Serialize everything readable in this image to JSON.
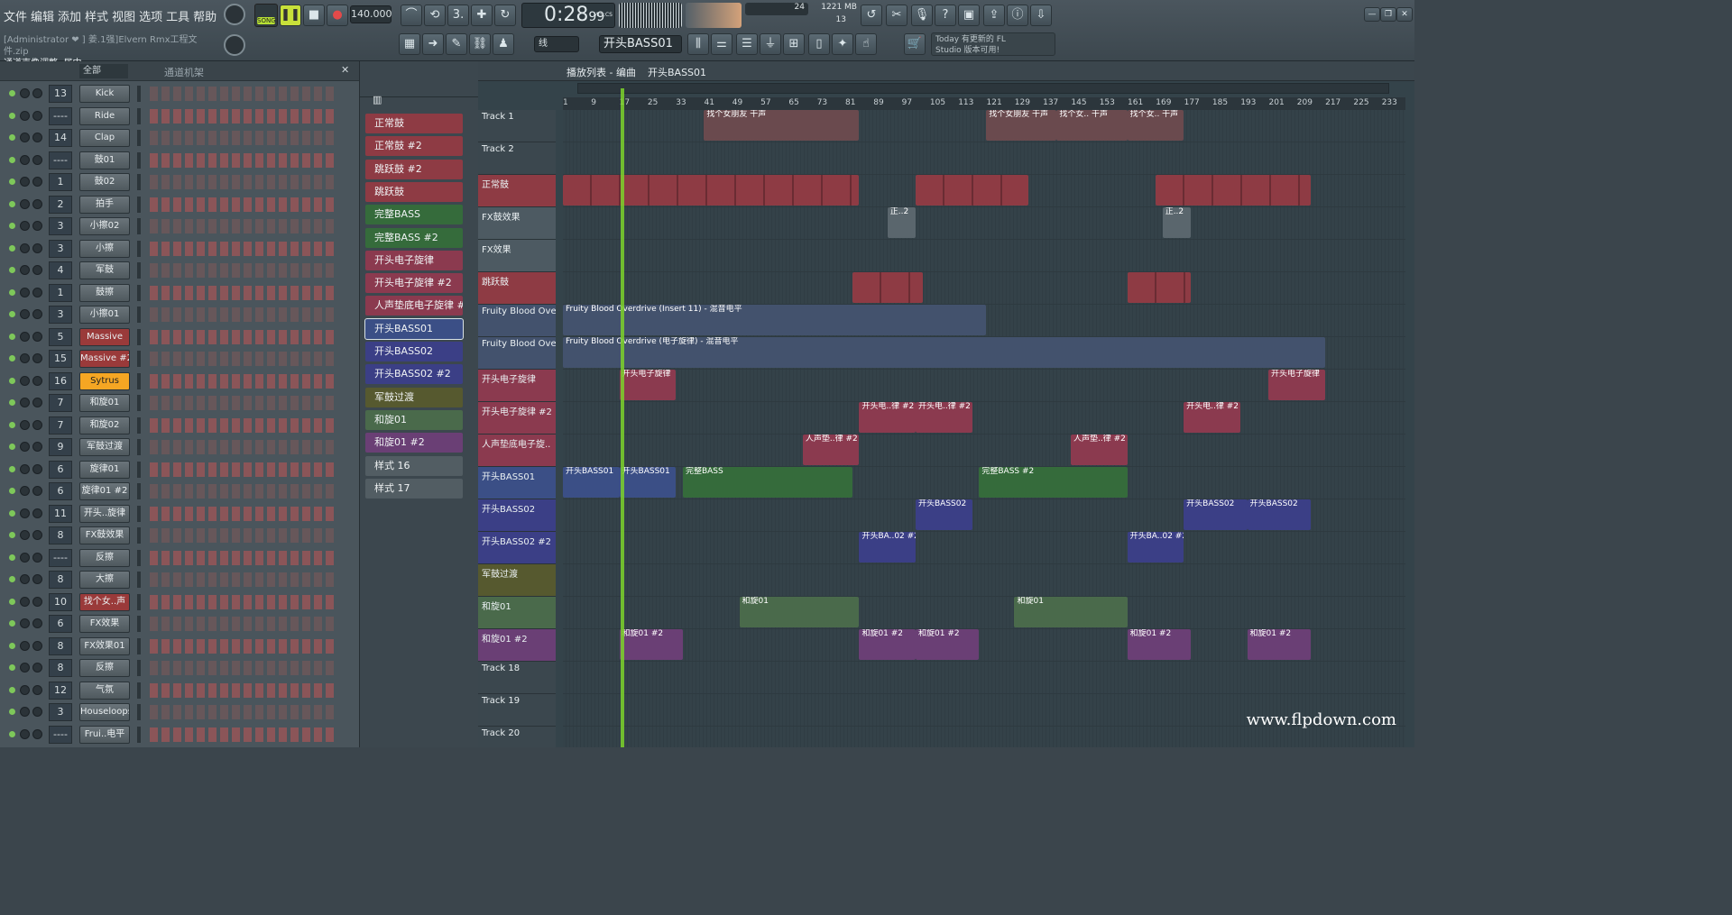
{
  "menu": [
    "文件",
    "编辑",
    "添加",
    "样式",
    "视图",
    "选项",
    "工具",
    "帮助"
  ],
  "transport": {
    "mode": "SONG",
    "bpm": "140.000",
    "time": "0:28",
    "time_sub": "99",
    "time_label": "M:S:CS",
    "cpu": "24",
    "mem": "1221 MB",
    "voices": "13"
  },
  "hint": {
    "line1": "[Administrator ❤ ] 姜.1强]Elvern Rmx工程文件.zip",
    "line2": "通道声像调整: 居中"
  },
  "snap": "线",
  "pattern_selector": "开头BASS01",
  "news": {
    "line1": "Today 有更新的 FL",
    "line2": "Studio 版本可用!"
  },
  "channel_rack": {
    "filter": "全部",
    "title": "通道机架",
    "rows": [
      {
        "num": "13",
        "name": "Kick"
      },
      {
        "num": "----",
        "name": "Ride"
      },
      {
        "num": "14",
        "name": "Clap"
      },
      {
        "num": "----",
        "name": "鼓01"
      },
      {
        "num": "1",
        "name": "鼓02"
      },
      {
        "num": "2",
        "name": "拍手"
      },
      {
        "num": "3",
        "name": "小擦02"
      },
      {
        "num": "3",
        "name": "小擦"
      },
      {
        "num": "4",
        "name": "军鼓"
      },
      {
        "num": "1",
        "name": "鼓擦"
      },
      {
        "num": "3",
        "name": "小擦01"
      },
      {
        "num": "5",
        "name": "Massive"
      },
      {
        "num": "15",
        "name": "Massive #2"
      },
      {
        "num": "16",
        "name": "Sytrus"
      },
      {
        "num": "7",
        "name": "和旋01"
      },
      {
        "num": "7",
        "name": "和旋02"
      },
      {
        "num": "9",
        "name": "军鼓过渡"
      },
      {
        "num": "6",
        "name": "旋律01"
      },
      {
        "num": "6",
        "name": "旋律01 #2"
      },
      {
        "num": "11",
        "name": "开头..旋律"
      },
      {
        "num": "8",
        "name": "FX鼓效果"
      },
      {
        "num": "----",
        "name": "反擦"
      },
      {
        "num": "8",
        "name": "大擦"
      },
      {
        "num": "10",
        "name": "找个女..声"
      },
      {
        "num": "6",
        "name": "FX效果"
      },
      {
        "num": "8",
        "name": "FX效果01"
      },
      {
        "num": "8",
        "name": "反擦"
      },
      {
        "num": "12",
        "name": "气氛"
      },
      {
        "num": "3",
        "name": "Houseloops"
      },
      {
        "num": "----",
        "name": "Frui..电平"
      }
    ]
  },
  "patterns": [
    {
      "name": "正常鼓",
      "color": "#8e3b44"
    },
    {
      "name": "正常鼓 #2",
      "color": "#8e3b44"
    },
    {
      "name": "跳跃鼓 #2",
      "color": "#8e3b44"
    },
    {
      "name": "跳跃鼓",
      "color": "#8e3b44"
    },
    {
      "name": "完整BASS",
      "color": "#356b3b"
    },
    {
      "name": "完整BASS #2",
      "color": "#356b3b"
    },
    {
      "name": "开头电子旋律",
      "color": "#8b3a4f"
    },
    {
      "name": "开头电子旋律 #2",
      "color": "#8b3a4f"
    },
    {
      "name": "人声垫底电子旋律 #2",
      "color": "#8b3a4f"
    },
    {
      "name": "开头BASS01",
      "color": "#3b4f86"
    },
    {
      "name": "开头BASS02",
      "color": "#3b3f86"
    },
    {
      "name": "开头BASS02 #2",
      "color": "#3b3f86"
    },
    {
      "name": "军鼓过渡",
      "color": "#56592f"
    },
    {
      "name": "和旋01",
      "color": "#4a6a4b"
    },
    {
      "name": "和旋01 #2",
      "color": "#6a3f75"
    },
    {
      "name": "样式 16",
      "color": "#525d63"
    },
    {
      "name": "样式 17",
      "color": "#525d63"
    }
  ],
  "playlist": {
    "title": "播放列表 - 编曲",
    "crumb": "开头BASS01",
    "ruler": [
      "1",
      "9",
      "17",
      "25",
      "33",
      "41",
      "49",
      "57",
      "65",
      "73",
      "81",
      "89",
      "97",
      "105",
      "113",
      "121",
      "129",
      "137",
      "145",
      "153",
      "161",
      "169",
      "177",
      "185",
      "193",
      "201",
      "209",
      "217",
      "225",
      "233"
    ],
    "tracks": [
      {
        "name": "Track 1",
        "color": "#3b474e"
      },
      {
        "name": "Track 2",
        "color": "#3b474e"
      },
      {
        "name": "正常鼓",
        "color": "#8e3b44"
      },
      {
        "name": "FX鼓效果",
        "color": "#4d5a62"
      },
      {
        "name": "FX效果",
        "color": "#4d5a62"
      },
      {
        "name": "跳跃鼓",
        "color": "#8e3b44"
      },
      {
        "name": "Fruity Blood Overd..",
        "color": "#43526d"
      },
      {
        "name": "Fruity Blood Overd..",
        "color": "#43526d"
      },
      {
        "name": "开头电子旋律",
        "color": "#8b3a4f"
      },
      {
        "name": "开头电子旋律 #2",
        "color": "#8b3a4f"
      },
      {
        "name": "人声垫底电子旋..",
        "color": "#8b3a4f"
      },
      {
        "name": "开头BASS01",
        "color": "#3b4f86"
      },
      {
        "name": "开头BASS02",
        "color": "#3b3f86"
      },
      {
        "name": "开头BASS02 #2",
        "color": "#3b3f86"
      },
      {
        "name": "军鼓过渡",
        "color": "#56592f"
      },
      {
        "name": "和旋01",
        "color": "#4a6a4b"
      },
      {
        "name": "和旋01 #2",
        "color": "#6a3f75"
      },
      {
        "name": "Track 18",
        "color": "#3b474e"
      },
      {
        "name": "Track 19",
        "color": "#3b474e"
      },
      {
        "name": "Track 20",
        "color": "#3b474e"
      }
    ],
    "clips": {
      "audio1": "找个女朋友 干声",
      "audio2": "找个女朋友 干声",
      "audio3": "找个女.. 干声",
      "audio4": "找个女.. 干声",
      "auto1": "Fruity Blood Overdrive (Insert 11) - 混音电平",
      "auto2": "Fruity Blood Overdrive (电子旋律) - 混音电平",
      "fx1": "正..2",
      "fx2": "正..2",
      "mel1": "开头电子旋律",
      "mel2": "开头电子旋律",
      "mel2a": "开头电..律 #2",
      "mel2b": "开头电..律 #2",
      "mel2c": "开头电..律 #2",
      "vox1": "人声垫..律 #2",
      "vox2": "人声垫..律 #2",
      "b1a": "开头BASS01",
      "b1b": "开头BASS01",
      "full1": "完整BASS",
      "full2": "完整BASS #2",
      "b2a": "开头BASS02",
      "b2b": "开头BASS02",
      "b2c": "开头BASS02",
      "b22a": "开头BA..02 #2",
      "b22b": "开头BA..02 #2",
      "ch1": "和旋01",
      "ch2": "和旋01",
      "c2a": "和旋01 #2",
      "c2b": "和旋01 #2",
      "c2c": "和旋01 #2",
      "c2d": "和旋01 #2",
      "c2e": "和旋01 #2"
    }
  },
  "watermark": "www.flpdown.com",
  "colors": {
    "playhead": "#7dd22a",
    "audio": "#f08c8c",
    "drum": "#8e3b44"
  }
}
